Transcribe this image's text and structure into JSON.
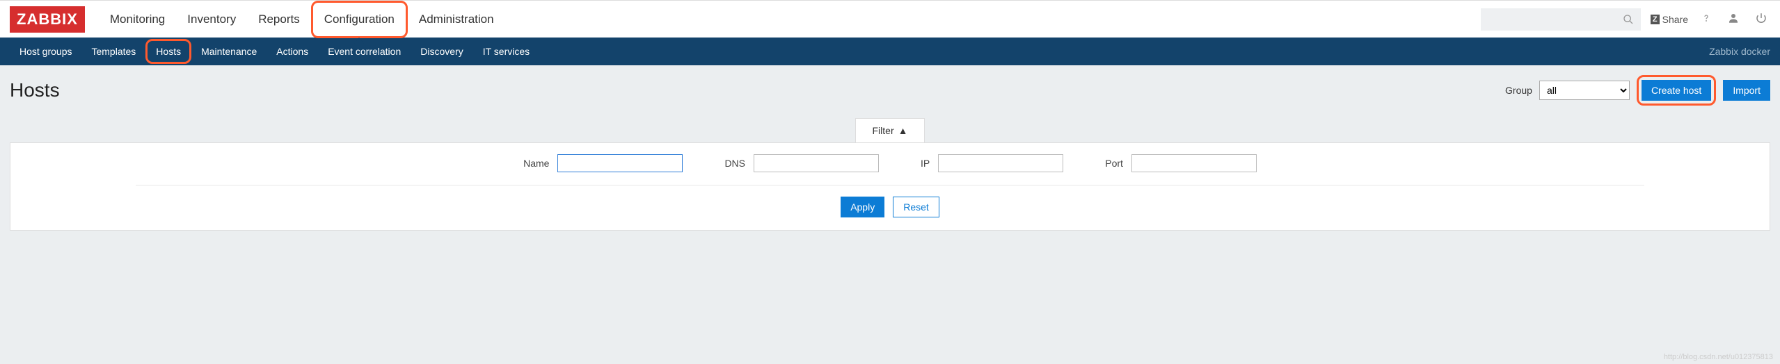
{
  "logo": "ZABBIX",
  "main_nav": {
    "items": [
      {
        "label": "Monitoring"
      },
      {
        "label": "Inventory"
      },
      {
        "label": "Reports"
      },
      {
        "label": "Configuration",
        "active": true
      },
      {
        "label": "Administration"
      }
    ]
  },
  "share_label": "Share",
  "sub_nav": {
    "items": [
      {
        "label": "Host groups"
      },
      {
        "label": "Templates"
      },
      {
        "label": "Hosts",
        "active": true
      },
      {
        "label": "Maintenance"
      },
      {
        "label": "Actions"
      },
      {
        "label": "Event correlation"
      },
      {
        "label": "Discovery"
      },
      {
        "label": "IT services"
      }
    ],
    "right_text": "Zabbix docker"
  },
  "page_title": "Hosts",
  "group": {
    "label": "Group",
    "selected": "all"
  },
  "create_host_label": "Create host",
  "import_label": "Import",
  "filter": {
    "tab_label": "Filter",
    "fields": {
      "name_label": "Name",
      "name_value": "",
      "dns_label": "DNS",
      "dns_value": "",
      "ip_label": "IP",
      "ip_value": "",
      "port_label": "Port",
      "port_value": ""
    },
    "apply_label": "Apply",
    "reset_label": "Reset"
  },
  "watermark": "http://blog.csdn.net/u012375813"
}
